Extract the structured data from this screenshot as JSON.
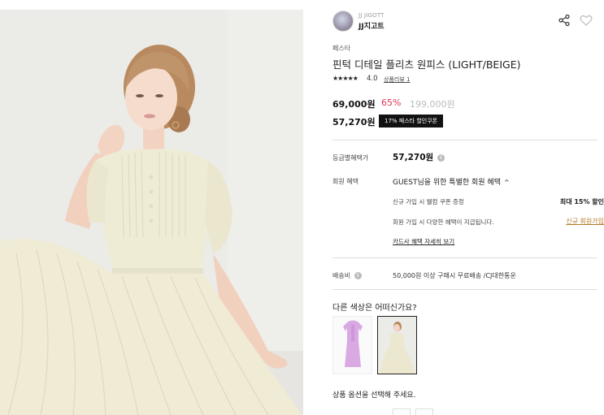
{
  "brand": {
    "sub": "JJ JIGOTT",
    "name": "JJ지고트"
  },
  "product": {
    "category": "페스타",
    "title": "핀턱 디테일 플리츠 원피스 (LIGHT/BEIGE)",
    "stars": "★★★★★",
    "rating": "4.0",
    "review_link": "상품리뷰 1",
    "price": "69,000원",
    "discount": "65%",
    "original_price": "199,000원",
    "coupon_price": "57,270원",
    "coupon_badge": "17% 페스타 할인쿠폰"
  },
  "benefits": {
    "grade_label": "등급별혜택가",
    "grade_price": "57,270원",
    "member_label": "회원 혜택",
    "member_head": "GUEST님을 위한 특별한 회원 혜택",
    "member_chevron": "^",
    "signup_coupon": "신규 가입 시 웰컴 쿠폰 증정",
    "max_discount": "최대 15% 할인",
    "signup_benefits": "회원 가입 시 다양한 혜택이 지급됩니다.",
    "signup_link": "신규 회원가입",
    "card_link": "카드사 혜택 자세히 보기"
  },
  "shipping": {
    "label": "배송비",
    "value": "50,000원 이상 구매시 무료배송 /CJ대한통운"
  },
  "colors": {
    "title": "다른 색상은 어떠신가요?",
    "items": [
      {
        "name": "lavender",
        "color": "#d9a9e4",
        "selected": false
      },
      {
        "name": "light-beige",
        "color": "#ece7cf",
        "selected": true
      }
    ]
  },
  "options": {
    "title": "상품 옵션을 선택해 주세요."
  },
  "icons": {
    "info": "i",
    "share": "share-icon",
    "heart": "heart-icon"
  },
  "theme": {
    "accent_discount": "#e03455",
    "signup_link_color": "#b67a2a",
    "badge_bg": "#111111"
  }
}
